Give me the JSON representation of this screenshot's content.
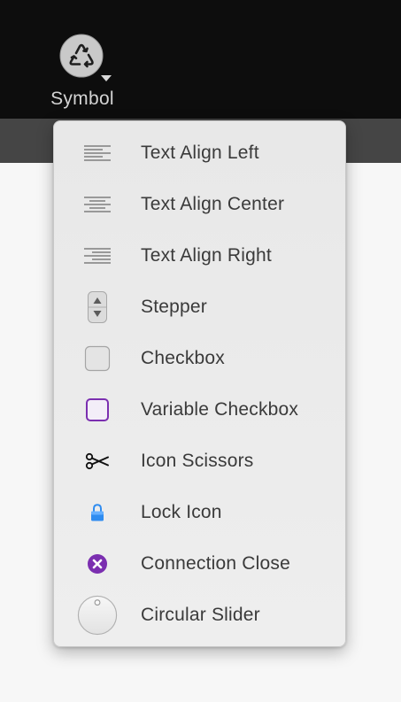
{
  "toolbar": {
    "symbol_tool": {
      "label": "Symbol",
      "icon": "recycle-icon"
    }
  },
  "menu": {
    "items": [
      {
        "label": "Text Align Left",
        "icon": "text-align-left-icon"
      },
      {
        "label": "Text Align Center",
        "icon": "text-align-center-icon"
      },
      {
        "label": "Text Align Right",
        "icon": "text-align-right-icon"
      },
      {
        "label": "Stepper",
        "icon": "stepper-icon"
      },
      {
        "label": "Checkbox",
        "icon": "checkbox-icon"
      },
      {
        "label": "Variable Checkbox",
        "icon": "variable-checkbox-icon"
      },
      {
        "label": "Icon Scissors",
        "icon": "scissors-icon"
      },
      {
        "label": "Lock Icon",
        "icon": "lock-icon"
      },
      {
        "label": "Connection Close",
        "icon": "connection-close-icon"
      },
      {
        "label": "Circular Slider",
        "icon": "circular-slider-icon"
      }
    ]
  },
  "colors": {
    "toolbar_bg": "#0d0d0d",
    "menu_bg": "#ececec",
    "menu_text": "#3a3a3a",
    "variable_checkbox": "#7b2fb0",
    "lock": "#2f8cf0",
    "connection_close": "#7b2fb0"
  }
}
